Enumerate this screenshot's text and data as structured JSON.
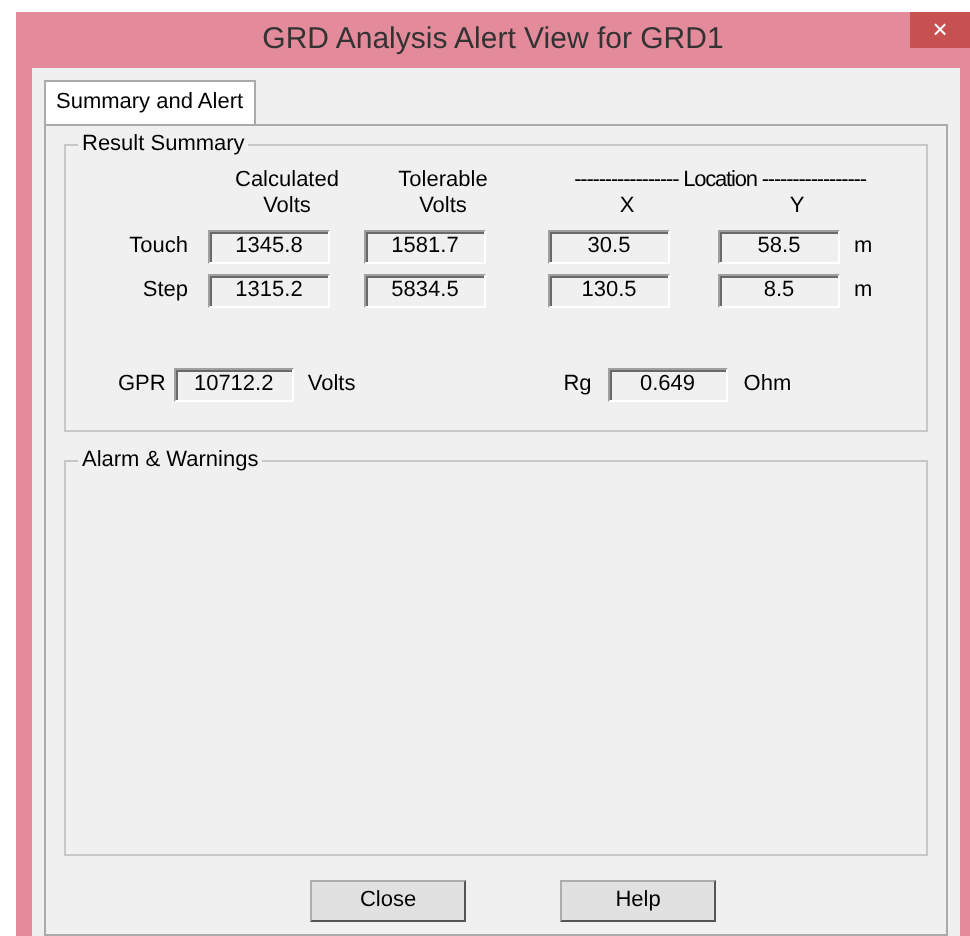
{
  "window": {
    "title": "GRD Analysis Alert View for GRD1",
    "close": "×"
  },
  "tabs": [
    {
      "label": "Summary and Alert",
      "selected": true
    }
  ],
  "result_summary": {
    "title": "Result Summary",
    "location_header": "----------------- Location -----------------",
    "columns": [
      "Calculated\nVolts",
      "Tolerable\nVolts",
      "X",
      "Y"
    ],
    "rows": [
      {
        "label": "Touch",
        "values": [
          "1345.8",
          "1581.7",
          "30.5",
          "58.5"
        ],
        "unit": "m"
      },
      {
        "label": "Step",
        "values": [
          "1315.2",
          "5834.5",
          "130.5",
          "8.5"
        ],
        "unit": "m"
      }
    ],
    "gpr": {
      "label": "GPR",
      "value": "10712.2",
      "unit": "Volts"
    },
    "rg": {
      "label": "Rg",
      "value": "0.649",
      "unit": "Ohm"
    }
  },
  "alarms": {
    "title": "Alarm & Warnings"
  },
  "buttons": [
    "Close",
    "Help"
  ]
}
